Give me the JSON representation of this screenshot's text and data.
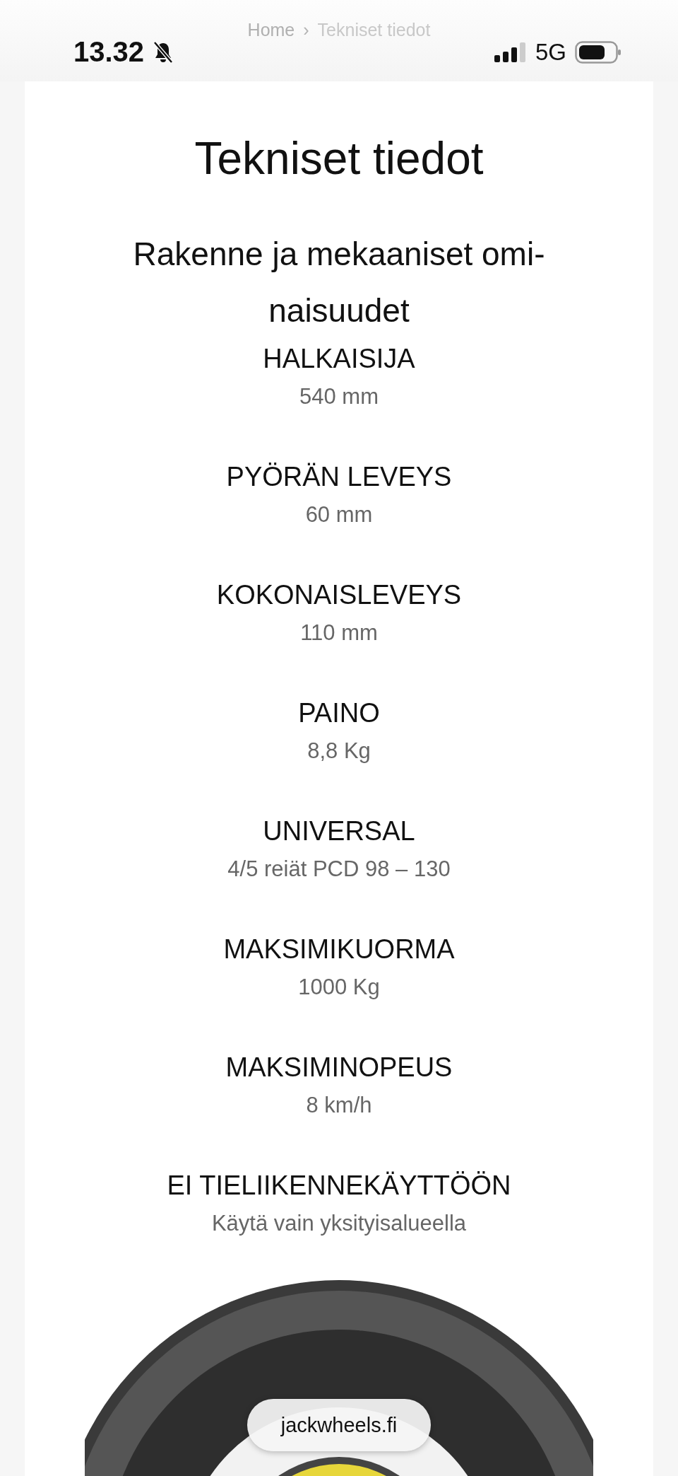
{
  "status_bar": {
    "time": "13.32",
    "network": "5G"
  },
  "breadcrumb": {
    "items": [
      "Home",
      "Tekniset tiedot"
    ],
    "separator": "›"
  },
  "title": "Tekniset tiedot",
  "section": {
    "heading_lines": [
      "Rakenne ja mekaaniset omi-",
      "naisuudet"
    ],
    "specs": [
      {
        "label": "HALKAISIJA",
        "value": "540 mm"
      },
      {
        "label": "PYÖRÄN LEVEYS",
        "value": "60 mm"
      },
      {
        "label": "KOKONAISLEVEYS",
        "value": "110 mm"
      },
      {
        "label": "PAINO",
        "value": "8,8 Kg"
      },
      {
        "label": "UNIVERSAL",
        "value": "4/5 reiät PCD 98 – 130"
      },
      {
        "label": "MAKSIMIKUORMA",
        "value": "1000 Kg"
      },
      {
        "label": "MAKSIMINOPEUS",
        "value": "8  km/h"
      },
      {
        "label": "EI TIELIIKENNEKÄYTTÖÖN",
        "value": "Käytä vain yksityisalueella"
      }
    ]
  },
  "url_pill": "jackwheels.fi"
}
